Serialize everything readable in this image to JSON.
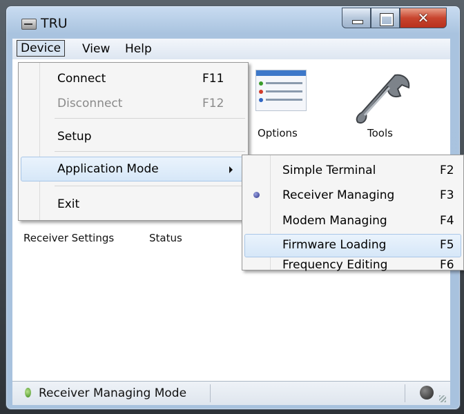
{
  "window": {
    "title": "TRU"
  },
  "menubar": {
    "device": "Device",
    "view": "View",
    "help": "Help"
  },
  "device_menu": {
    "items": [
      {
        "label": "Connect",
        "accel": "F11"
      },
      {
        "label": "Disconnect",
        "accel": "F12"
      },
      {
        "label": "Setup",
        "accel": ""
      },
      {
        "label": "Application Mode",
        "accel": ""
      },
      {
        "label": "Exit",
        "accel": ""
      }
    ]
  },
  "app_mode_menu": {
    "items": [
      {
        "label": "Simple Terminal",
        "accel": "F2"
      },
      {
        "label": "Receiver Managing",
        "accel": "F3"
      },
      {
        "label": "Modem Managing",
        "accel": "F4"
      },
      {
        "label": "Firmware Loading",
        "accel": "F5"
      },
      {
        "label": "Frequency Editing",
        "accel": "F6"
      }
    ]
  },
  "toolbar": {
    "options": "Options",
    "tools": "Tools",
    "receiver_settings": "Receiver Settings",
    "status": "Status"
  },
  "statusbar": {
    "text": "Receiver Managing Mode"
  }
}
